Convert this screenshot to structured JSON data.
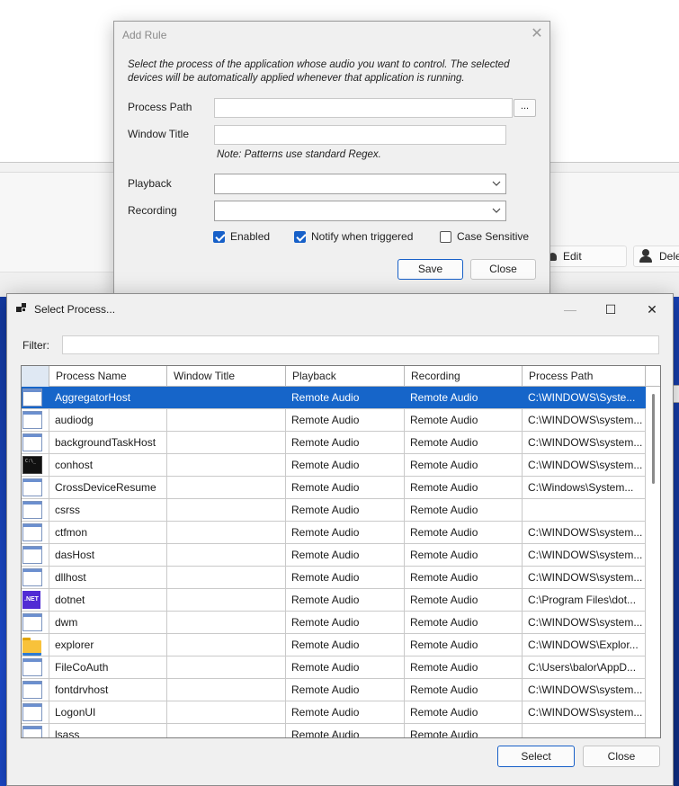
{
  "background": {
    "edit_label": "Edit",
    "delete_label": "Dele"
  },
  "add_rule": {
    "title": "Add Rule",
    "description": "Select the process of the application whose audio you want to control. The selected devices will be automatically applied whenever that application is running.",
    "process_path_label": "Process Path",
    "process_path_value": "",
    "browse_label": "...",
    "window_title_label": "Window Title",
    "window_title_value": "",
    "note": "Note: Patterns use standard Regex.",
    "playback_label": "Playback",
    "playback_value": "",
    "recording_label": "Recording",
    "recording_value": "",
    "enabled_label": "Enabled",
    "enabled_checked": true,
    "notify_label": "Notify when triggered",
    "notify_checked": true,
    "case_label": "Case Sensitive",
    "case_checked": false,
    "save_label": "Save",
    "close_label": "Close"
  },
  "select_process": {
    "title": "Select Process...",
    "filter_label": "Filter:",
    "filter_value": "",
    "columns": [
      "Process Name",
      "Window Title",
      "Playback",
      "Recording",
      "Process Path"
    ],
    "rows": [
      {
        "icon": "window-icon",
        "name": "AggregatorHost",
        "window_title": "",
        "playback": "Remote Audio",
        "recording": "Remote Audio",
        "path": "C:\\WINDOWS\\Syste...",
        "selected": true
      },
      {
        "icon": "window-icon",
        "name": "audiodg",
        "window_title": "",
        "playback": "Remote Audio",
        "recording": "Remote Audio",
        "path": "C:\\WINDOWS\\system..."
      },
      {
        "icon": "window-icon",
        "name": "backgroundTaskHost",
        "window_title": "",
        "playback": "Remote Audio",
        "recording": "Remote Audio",
        "path": "C:\\WINDOWS\\system..."
      },
      {
        "icon": "console-icon",
        "name": "conhost",
        "window_title": "",
        "playback": "Remote Audio",
        "recording": "Remote Audio",
        "path": "C:\\WINDOWS\\system..."
      },
      {
        "icon": "window-icon",
        "name": "CrossDeviceResume",
        "window_title": "",
        "playback": "Remote Audio",
        "recording": "Remote Audio",
        "path": "C:\\Windows\\System..."
      },
      {
        "icon": "window-icon",
        "name": "csrss",
        "window_title": "",
        "playback": "Remote Audio",
        "recording": "Remote Audio",
        "path": ""
      },
      {
        "icon": "window-icon",
        "name": "ctfmon",
        "window_title": "",
        "playback": "Remote Audio",
        "recording": "Remote Audio",
        "path": "C:\\WINDOWS\\system..."
      },
      {
        "icon": "window-icon",
        "name": "dasHost",
        "window_title": "",
        "playback": "Remote Audio",
        "recording": "Remote Audio",
        "path": "C:\\WINDOWS\\system..."
      },
      {
        "icon": "window-icon",
        "name": "dllhost",
        "window_title": "",
        "playback": "Remote Audio",
        "recording": "Remote Audio",
        "path": "C:\\WINDOWS\\system..."
      },
      {
        "icon": "dotnet-icon",
        "name": "dotnet",
        "window_title": "",
        "playback": "Remote Audio",
        "recording": "Remote Audio",
        "path": "C:\\Program Files\\dot..."
      },
      {
        "icon": "window-icon",
        "name": "dwm",
        "window_title": "",
        "playback": "Remote Audio",
        "recording": "Remote Audio",
        "path": "C:\\WINDOWS\\system..."
      },
      {
        "icon": "folder-icon",
        "name": "explorer",
        "window_title": "",
        "playback": "Remote Audio",
        "recording": "Remote Audio",
        "path": "C:\\WINDOWS\\Explor..."
      },
      {
        "icon": "window-icon",
        "name": "FileCoAuth",
        "window_title": "",
        "playback": "Remote Audio",
        "recording": "Remote Audio",
        "path": "C:\\Users\\balor\\AppD..."
      },
      {
        "icon": "window-icon",
        "name": "fontdrvhost",
        "window_title": "",
        "playback": "Remote Audio",
        "recording": "Remote Audio",
        "path": "C:\\WINDOWS\\system..."
      },
      {
        "icon": "window-icon",
        "name": "LogonUI",
        "window_title": "",
        "playback": "Remote Audio",
        "recording": "Remote Audio",
        "path": "C:\\WINDOWS\\system..."
      },
      {
        "icon": "window-icon",
        "name": "lsass",
        "window_title": "",
        "playback": "Remote Audio",
        "recording": "Remote Audio",
        "path": ""
      }
    ],
    "select_label": "Select",
    "close_label": "Close"
  }
}
